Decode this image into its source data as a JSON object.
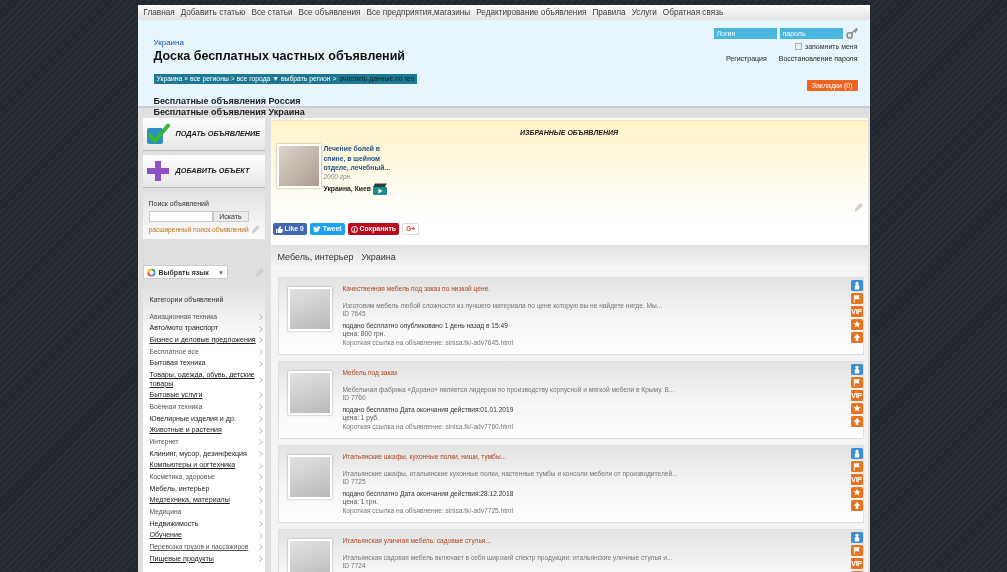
{
  "nav": [
    "Главная",
    "Добавить статью",
    "Все статьи",
    "Все объявления",
    "Все предприятия,магазины",
    "Редактирование объявления",
    "Правила",
    "Услуги",
    "Обратная связь"
  ],
  "header": {
    "region": "Украина",
    "title": "Доска бесплатных частных объявлений",
    "breadcrumb": {
      "path": "Украина » все регионы > все города ▼ выбрать регион >",
      "clear_link": "очистить данные по гео"
    },
    "site_links": [
      "Бесплатные объявления Россия",
      "Бесплатные объявления Украина"
    ]
  },
  "login": {
    "login_placeholder": "Логин",
    "password_placeholder": "пароль",
    "remember": {
      "label": "запомнить меня",
      "checked": false
    },
    "links": [
      "Регистрация",
      "Восстановление пароля"
    ],
    "bookmarks_button": "Закладки (0)"
  },
  "sidebar": {
    "actions": [
      {
        "kind": "check",
        "label": "ПОДАТЬ ОБЪЯВЛЕНИЕ"
      },
      {
        "kind": "plus",
        "label": "ДОБАВИТЬ ОБЪЕКТ"
      }
    ],
    "search": {
      "title": "Поиск объявлений",
      "button": "Искать",
      "advanced_link": "расширенный поиск объявлений"
    },
    "translate": {
      "label": "Выбрать язык",
      "caret": "▼"
    },
    "categories": {
      "title": "Категории объявлений",
      "items": [
        {
          "label": "Авиационная техника",
          "underlined": false,
          "small": true
        },
        {
          "label": "Авто/мото транспорт",
          "underlined": false,
          "small": false
        },
        {
          "label": "Бизнес и деловые предложения",
          "underlined": true,
          "small": false
        },
        {
          "label": "Бесплатное все",
          "underlined": false,
          "small": true
        },
        {
          "label": "Бытовая техника",
          "underlined": false,
          "small": false
        },
        {
          "label": "Товары, одежда, обувь, детские товары",
          "underlined": true,
          "small": false
        },
        {
          "label": "Бытовые услуги",
          "underlined": true,
          "small": false
        },
        {
          "label": "Военная техника",
          "underlined": false,
          "small": true
        },
        {
          "label": "Ювелирные изделия и др.",
          "underlined": false,
          "small": false
        },
        {
          "label": "Животные и растения",
          "underlined": true,
          "small": false
        },
        {
          "label": "Интернет",
          "underlined": false,
          "small": true
        },
        {
          "label": "Клининг, мусор, дезинфекция",
          "underlined": false,
          "small": false
        },
        {
          "label": "Компьютеры и оргтехника",
          "underlined": true,
          "small": false
        },
        {
          "label": "Косметика, здоровье",
          "underlined": false,
          "small": true
        },
        {
          "label": "Мебель, интерьер",
          "underlined": false,
          "small": false
        },
        {
          "label": "Медтехника, материалы",
          "underlined": true,
          "small": false
        },
        {
          "label": "Медицина",
          "underlined": false,
          "small": true
        },
        {
          "label": "Недвижимость",
          "underlined": false,
          "small": false
        },
        {
          "label": "Обучение",
          "underlined": true,
          "small": false
        },
        {
          "label": "Перевозка грузов и пассажиров",
          "underlined": true,
          "small": true
        },
        {
          "label": "Пищевые продукты",
          "underlined": true,
          "small": false
        }
      ]
    }
  },
  "featured": {
    "title": "ИЗБРАННЫЕ ОБЪЯВЛЕНИЯ",
    "items": [
      {
        "title": "Лечение болей в спине, в шейном отделе, лечебный...",
        "price": "2000 грн.",
        "location": "Украина, Киев",
        "video": true
      }
    ]
  },
  "share": [
    {
      "kind": "facebook",
      "label": "Like 0"
    },
    {
      "kind": "twitter",
      "label": "Tweet"
    },
    {
      "kind": "pinterest",
      "label": "Сохранить"
    },
    {
      "kind": "gplus",
      "label": "G+"
    }
  ],
  "listing_heading": {
    "category": "Мебель, интерьер",
    "region": "Украина"
  },
  "listings": [
    {
      "title": "Качественная мебель под заказ по низкой цене.",
      "description": "Изготовим мебель любой сложности из лучшего материала по цене которую вы не найдете нигде. Мы...",
      "id": "ID 7645",
      "posted": "подано бесплатно опубликовано 1 день назад в 15:49",
      "price": "цена: 800 грн.",
      "short_link": "Короткая ссылка на объявление: sinisa.tk/-adv7645.html",
      "vip": "VIP"
    },
    {
      "title": "Мебель под заказ",
      "description": "Мебельная фабрика «Дорано» является лидером по производству корпусной и мягкой мебели в Крыму. В...",
      "id": "ID 7760",
      "posted": "подано бесплатно Дата окончания действия:01.01.2019",
      "price": "цена: 1 руб.",
      "short_link": "Короткая ссылка на объявление: sinisa.tk/-adv7760.html",
      "vip": "VIP"
    },
    {
      "title": "Итальянские шкафы, кухонные полки, ниши, тумбы...",
      "description": "Итальянские шкафы, итальянские кухонные полки, настенные тумбы и консоли мебели от производителей...",
      "id": "ID 7725",
      "posted": "подано бесплатно Дата окончания действия:28.12.2018",
      "price": "цена: 1 грн.",
      "short_link": "Короткая ссылка на объявление: sinisa.tk/-adv7725.html",
      "vip": "VIP"
    },
    {
      "title": "Итальянская уличная мебель: садовые стулья...",
      "description": "Итальянская садовая мебель включает в себя широкий спектр продукции: итальянские уличные стулья и...",
      "id": "ID 7724",
      "vip": "VIP"
    }
  ]
}
